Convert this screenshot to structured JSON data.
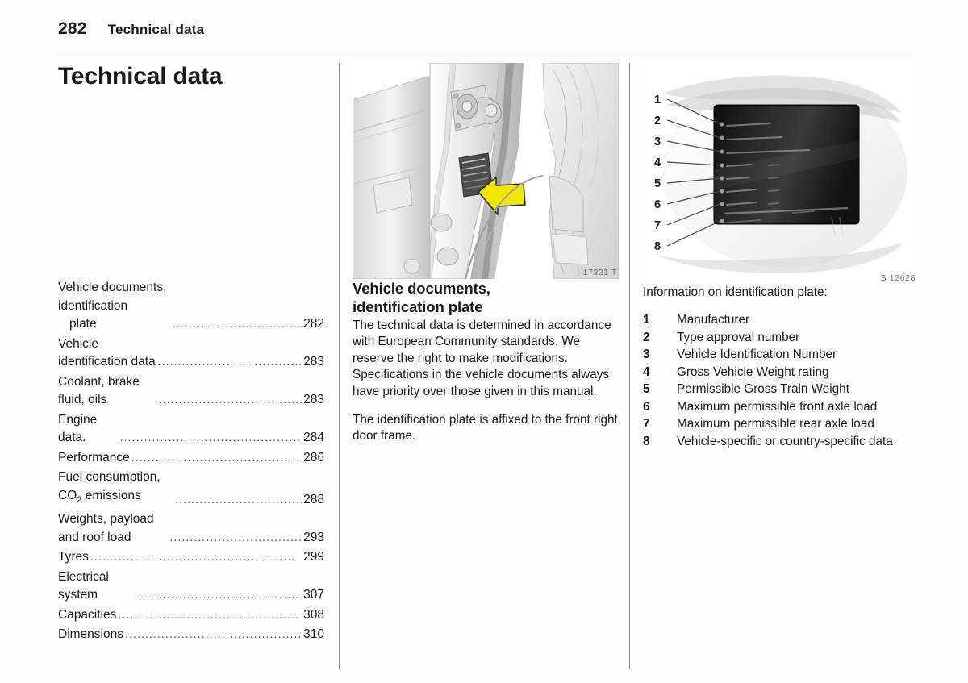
{
  "header": {
    "folio": "282",
    "chapter": "Technical data"
  },
  "column_left": {
    "chapter_title": "Technical data",
    "toc": [
      {
        "label": "Vehicle documents, identification",
        "label_cont": "plate",
        "page": "282"
      },
      {
        "label": "Vehicle identification data",
        "page": "283"
      },
      {
        "label": "Coolant, brake fluid, oils",
        "page": "283"
      },
      {
        "label": "Engine data.",
        "page": "284"
      },
      {
        "label": "Performance",
        "page": "286"
      },
      {
        "label": "Fuel consumption, CO2 emissions",
        "label_html": "Fuel consumption, CO<sub>2</sub> emissions",
        "page": "288"
      },
      {
        "label": "Weights, payload and roof load",
        "page": "293"
      },
      {
        "label": "Tyres",
        "page": "299"
      },
      {
        "label": "Electrical system",
        "page": "307"
      },
      {
        "label": "Capacities",
        "page": "308"
      },
      {
        "label": "Dimensions",
        "page": "310"
      }
    ],
    "dot_leader": "...................................................."
  },
  "column_middle": {
    "figure_caption": "17321 T",
    "figure_name": "front-right-door-frame-identification-plate-location",
    "heading_line1": "Vehicle documents,",
    "heading_line2": "identification plate",
    "paragraph1": "The technical data is determined in accordance with European Community standards. We reserve the right to make modifications. Specifications in the vehicle documents always have priority over those given in this manual.",
    "paragraph2": "The identification plate is affixed to the front right door frame."
  },
  "column_right": {
    "figure_caption": "S 12628",
    "figure_name": "identification-plate-diagram",
    "callout_numbers": [
      "1",
      "2",
      "3",
      "4",
      "5",
      "6",
      "7",
      "8"
    ],
    "plate_lines": [
      "VAUXHALL",
      "e1*98/14*0???",
      "W0L 4744C51?0?0?1",
      "1755            kg",
      "4050            kg",
      "1 1150          kg",
      "2 1150          kg",
      "BAC          AAJ",
      "BP/8/6"
    ],
    "intro": "Information on identification plate:",
    "legend": [
      {
        "num": "1",
        "text": "Manufacturer"
      },
      {
        "num": "2",
        "text": "Type approval number"
      },
      {
        "num": "3",
        "text": "Vehicle Identification Number"
      },
      {
        "num": "4",
        "text": "Gross Vehicle Weight rating"
      },
      {
        "num": "5",
        "text": "Permissible Gross Train Weight"
      },
      {
        "num": "6",
        "text": "Maximum permissible front axle load"
      },
      {
        "num": "7",
        "text": "Maximum permissible rear axle load"
      },
      {
        "num": "8",
        "text": "Vehicle-specific or country-specific data"
      }
    ]
  },
  "colors": {
    "arrow_yellow": "#f2e500",
    "rule_gray": "#8d8d8d",
    "plate_black": "#111111",
    "text": "#1a1a1a"
  }
}
